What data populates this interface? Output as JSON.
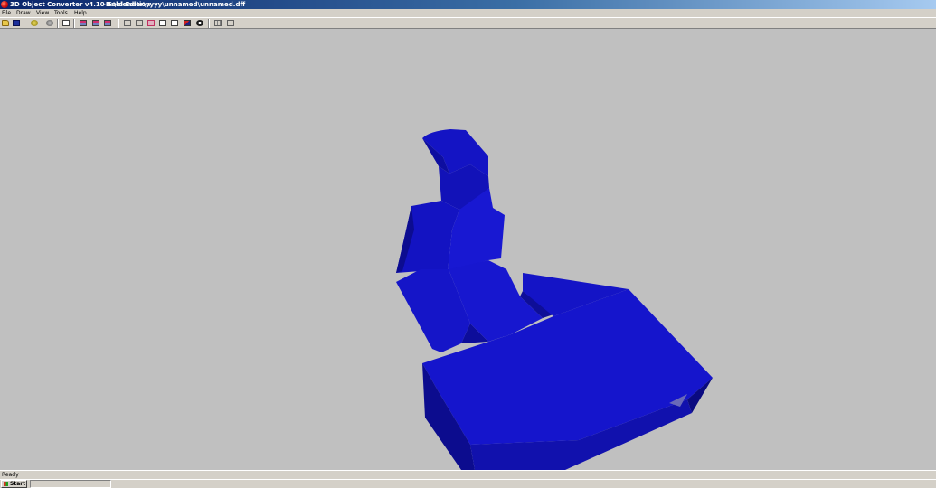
{
  "window": {
    "title": "3D Object Converter v4.10 Gold Edition",
    "path": "-D:\\blender\\yyyy\\unnamed\\unnamed.dff"
  },
  "menu": {
    "items": [
      {
        "label": "File"
      },
      {
        "label": "Draw"
      },
      {
        "label": "View"
      },
      {
        "label": "Tools"
      },
      {
        "label": "Help"
      }
    ]
  },
  "toolbar": {
    "buttons": [
      {
        "icon": "open-folder-icon"
      },
      {
        "icon": "save-icon"
      },
      {
        "icon": "reload-icon"
      },
      {
        "icon": "settings-icon"
      },
      {
        "icon": "print-icon"
      },
      {
        "icon": "snapshot-icon"
      },
      {
        "icon": "snapshot-icon"
      },
      {
        "icon": "snapshot-icon"
      },
      {
        "icon": "view-front-icon"
      },
      {
        "icon": "view-back-icon"
      },
      {
        "icon": "view-side-icon"
      },
      {
        "icon": "view-top-icon"
      },
      {
        "icon": "wireframe-icon"
      },
      {
        "icon": "shaded-icon"
      },
      {
        "icon": "texture-icon"
      },
      {
        "icon": "grid-icon"
      },
      {
        "icon": "grid-options-icon"
      }
    ]
  },
  "viewport": {
    "model_color": "#1515c8",
    "background_color": "#c0c0c0"
  },
  "status": {
    "text": "Ready"
  },
  "taskbar": {
    "start_label": "Start"
  },
  "colors": {
    "title_start": "#0a246a",
    "title_end": "#a6caf0",
    "chrome": "#d4d0c8"
  }
}
